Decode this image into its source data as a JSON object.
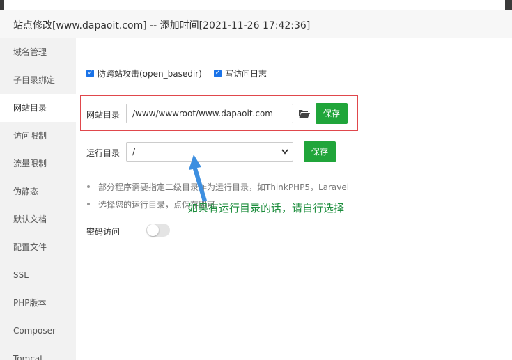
{
  "dialog": {
    "title": "站点修改[www.dapaoit.com] -- 添加时间[2021-11-26 17:42:36]"
  },
  "sidebar": {
    "items": [
      {
        "label": "域名管理"
      },
      {
        "label": "子目录绑定"
      },
      {
        "label": "网站目录",
        "active": true
      },
      {
        "label": "访问限制"
      },
      {
        "label": "流量限制"
      },
      {
        "label": "伪静态"
      },
      {
        "label": "默认文档"
      },
      {
        "label": "配置文件"
      },
      {
        "label": "SSL"
      },
      {
        "label": "PHP版本"
      },
      {
        "label": "Composer"
      },
      {
        "label": "Tomcat"
      }
    ]
  },
  "options": {
    "open_basedir": {
      "label": "防跨站攻击(open_basedir)",
      "checked": true
    },
    "access_log": {
      "label": "写访问日志",
      "checked": true
    }
  },
  "site_dir": {
    "label": "网站目录",
    "value": "/www/wwwroot/www.dapaoit.com",
    "folder_icon": "folder-open-icon",
    "save_label": "保存"
  },
  "run_dir": {
    "label": "运行目录",
    "selected": "/",
    "save_label": "保存"
  },
  "tips": [
    "部分程序需要指定二级目录作为运行目录，如ThinkPHP5，Laravel",
    "选择您的运行目录，点保存即可"
  ],
  "password_access": {
    "label": "密码访问",
    "enabled": false
  },
  "annotation": {
    "text": "如果有运行目录的话，请自行选择"
  },
  "colors": {
    "primary_button": "#20a53a",
    "checkbox": "#1a73e8",
    "highlight_box": "#e0474c",
    "annotation_text": "#1e8e3e",
    "arrow": "#3d8fe0"
  }
}
